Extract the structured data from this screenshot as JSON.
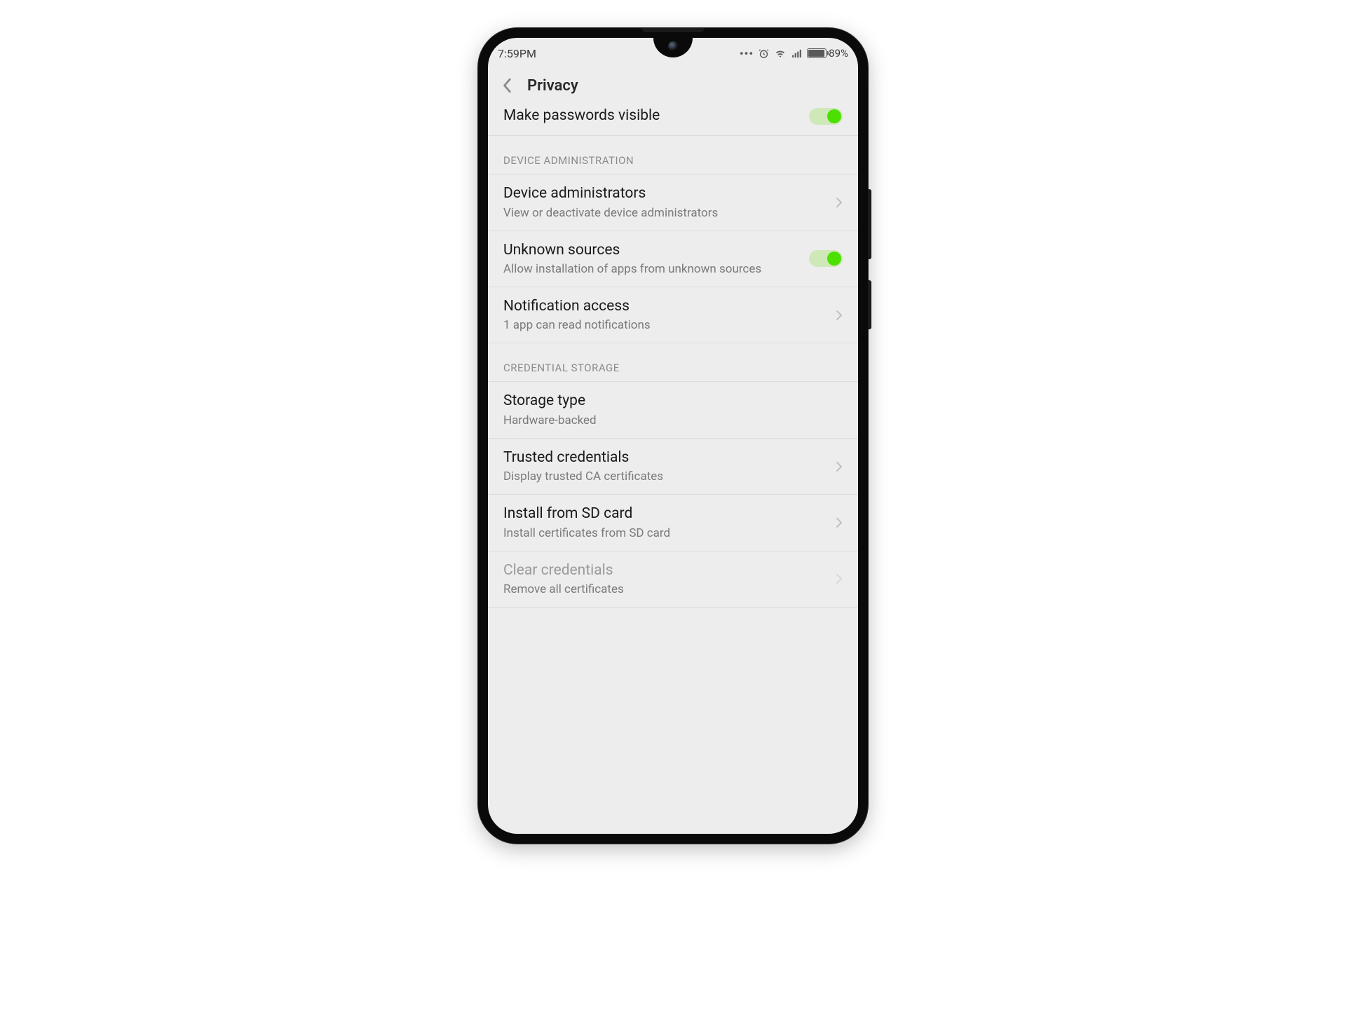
{
  "status_bar": {
    "time": "7:59PM",
    "battery_pct": "89%"
  },
  "header": {
    "title": "Privacy"
  },
  "rows": {
    "passwords": {
      "title": "Make passwords visible",
      "toggle_on": true
    },
    "section_device_admin": "DEVICE ADMINISTRATION",
    "device_admins": {
      "title": "Device administrators",
      "subtitle": "View or deactivate device administrators"
    },
    "unknown_sources": {
      "title": "Unknown sources",
      "subtitle": "Allow installation of apps from unknown sources",
      "toggle_on": true
    },
    "notification_access": {
      "title": "Notification access",
      "subtitle": "1 app can read notifications"
    },
    "section_cred_storage": "CREDENTIAL STORAGE",
    "storage_type": {
      "title": "Storage type",
      "subtitle": "Hardware-backed"
    },
    "trusted_creds": {
      "title": "Trusted credentials",
      "subtitle": "Display trusted CA certificates"
    },
    "install_sd": {
      "title": "Install from SD card",
      "subtitle": "Install certificates from SD card"
    },
    "clear_creds": {
      "title": "Clear credentials",
      "subtitle": "Remove all certificates"
    }
  }
}
